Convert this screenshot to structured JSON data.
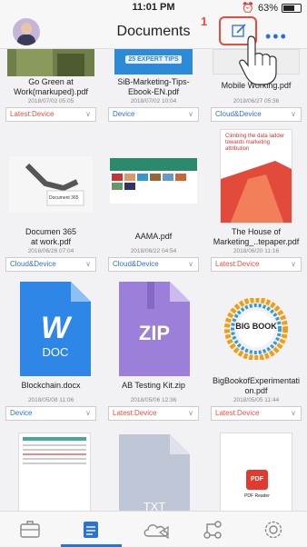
{
  "status": {
    "time": "11:01 PM",
    "battery": "63%"
  },
  "nav": {
    "title": "Documents",
    "step": "1",
    "more": "•••"
  },
  "files": [
    {
      "name1": "Go Green at",
      "name2": "Work(markuped).pdf",
      "date": "2018/07/02 05:05",
      "location": "Latest:Device",
      "status": "red",
      "thumb": "photo-green"
    },
    {
      "name1": "SiB-Marketing-Tips-",
      "name2": "Ebook-EN.pdf",
      "date": "2018/07/02 10:04",
      "location": "Device",
      "status": "blue",
      "thumb": "ebook",
      "thumb_text": "25 EXPERT TIPS"
    },
    {
      "name1": "Mobile Working.pdf",
      "name2": "",
      "date": "2018/06/27 05:36",
      "location": "Cloud&Device",
      "status": "blue",
      "thumb": "mobile"
    },
    {
      "name1": "Documen 365",
      "name2": "at work.pdf",
      "date": "2018/06/26 07:04",
      "location": "Cloud&Device",
      "status": "blue",
      "thumb": "doc365",
      "thumb_text": "Document 365"
    },
    {
      "name1": "AAMA.pdf",
      "name2": "",
      "date": "2018/06/22 04:54",
      "location": "Cloud&Device",
      "status": "blue",
      "thumb": "aama"
    },
    {
      "name1": "The House of",
      "name2": "Marketing_..tepaper.pdf",
      "date": "2018/06/20 11:16",
      "location": "Latest:Device",
      "status": "red",
      "thumb": "house",
      "thumb_text": "Climbing the data ladder towards marketing attribution"
    },
    {
      "name1": "Blockchain.docx",
      "name2": "",
      "date": "2018/05/08 11:06",
      "location": "Device",
      "status": "blue",
      "thumb": "word",
      "thumb_text": "DOC"
    },
    {
      "name1": "AB Testing Kit.zip",
      "name2": "",
      "date": "2018/05/06 12:36",
      "location": "Latest:Device",
      "status": "red",
      "thumb": "zip",
      "thumb_text": "ZIP"
    },
    {
      "name1": "BigBookofExperimentati",
      "name2": "on.pdf",
      "date": "2018/05/05 11:44",
      "location": "Latest:Device",
      "status": "red",
      "thumb": "bigbook",
      "thumb_text": "BIG BOOK"
    },
    {
      "name1": "",
      "name2": "",
      "date": "",
      "location": "",
      "status": "",
      "thumb": "sheet"
    },
    {
      "name1": "",
      "name2": "",
      "date": "",
      "location": "",
      "status": "",
      "thumb": "txt",
      "thumb_text": "TXT"
    },
    {
      "name1": "",
      "name2": "",
      "date": "",
      "location": "",
      "status": "",
      "thumb": "pdfreader",
      "thumb_text": "PDF Reader"
    }
  ],
  "tabs": [
    "briefcase-icon",
    "documents-icon",
    "cloud-icon",
    "connections-icon",
    "settings-icon"
  ],
  "colors": {
    "accent": "#2a72d6",
    "alert": "#e84c3d"
  }
}
